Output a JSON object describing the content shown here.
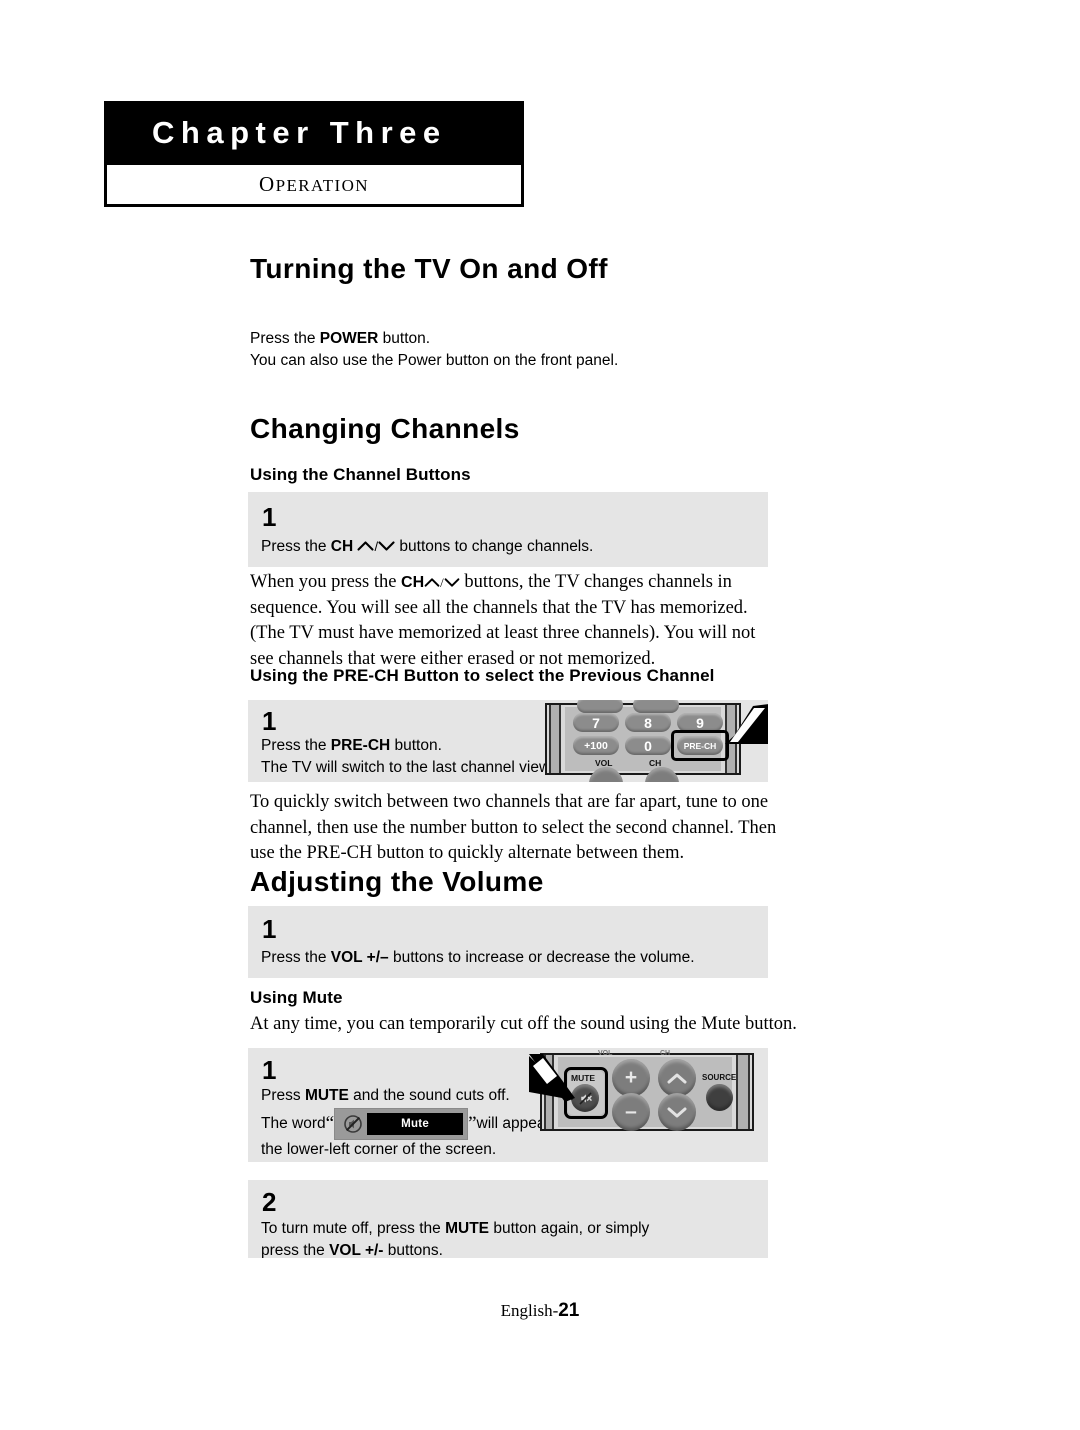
{
  "header": {
    "chapter_title": "Chapter Three",
    "chapter_subtitle": "OPERATION"
  },
  "sections": {
    "turning_on_off": {
      "title": "Turning the TV On and Off",
      "line1_a": "Press the ",
      "line1_b": "POWER",
      "line1_c": " button.",
      "line2": "You can also use the Power button on the front panel."
    },
    "changing_channels": {
      "title": "Changing Channels",
      "using_channel_buttons": {
        "heading": "Using the Channel Buttons",
        "step_number": "1",
        "text_a": "Press the ",
        "text_b": "CH",
        "text_c": " buttons to change channels.",
        "separator": "/"
      },
      "paragraph_a": "When you press the ",
      "paragraph_b": "CH",
      "paragraph_c": " buttons, the TV changes channels in sequence. You will see all the channels that the TV has memorized. (The TV must have memorized at least three channels). You will not see channels that were either erased or not memorized.",
      "pre_ch": {
        "heading": "Using the PRE-CH Button to select the Previous Channel",
        "step_number": "1",
        "line1_a": "Press the ",
        "line1_b": "PRE-CH",
        "line1_c": " button.",
        "line2": "The TV will switch to the last channel viewed.",
        "paragraph": "To quickly switch between two channels that are far apart, tune to one channel, then use the number button to select the second channel. Then use the PRE-CH button to quickly alternate between them."
      }
    },
    "adjusting_volume": {
      "title": "Adjusting the Volume",
      "step_number": "1",
      "text_a": "Press the ",
      "text_b": "VOL +/–",
      "text_c": " buttons to increase or decrease the volume.",
      "using_mute": {
        "heading": "Using Mute",
        "intro": "At any time, you can temporarily cut off the sound using the Mute button.",
        "step1_number": "1",
        "step1_line1_a": "Press ",
        "step1_line1_b": "MUTE",
        "step1_line1_c": " and the sound cuts off.",
        "step1_line2_a": "The word ",
        "step1_line2_b": " will appear in",
        "step1_line3": "the lower-left corner of the screen.",
        "osd_label": "Mute",
        "quote_open": "“",
        "quote_close": "”",
        "step2_number": "2",
        "step2_line1_a": "To turn mute off, press the ",
        "step2_line1_b": "MUTE",
        "step2_line1_c": " button again, or simply",
        "step2_line2_a": "press the ",
        "step2_line2_b": "VOL +/-",
        "step2_line2_c": " buttons."
      }
    }
  },
  "remote_prech": {
    "buttons": [
      "7",
      "8",
      "9",
      "+100",
      "0",
      "PRE-CH"
    ],
    "labels": [
      "VOL",
      "CH"
    ]
  },
  "remote_mute": {
    "mute_label": "MUTE",
    "plus_label": "+",
    "minus_label": "–",
    "source_label": "SOURCE"
  },
  "footer": {
    "prefix": "English-",
    "page": "21"
  },
  "colors": {
    "step_box_bg": "#e5e5e5",
    "chapter_bar_bg": "#000000",
    "remote_shell": "#d9d9d9",
    "remote_button": "#8c8c8c"
  }
}
